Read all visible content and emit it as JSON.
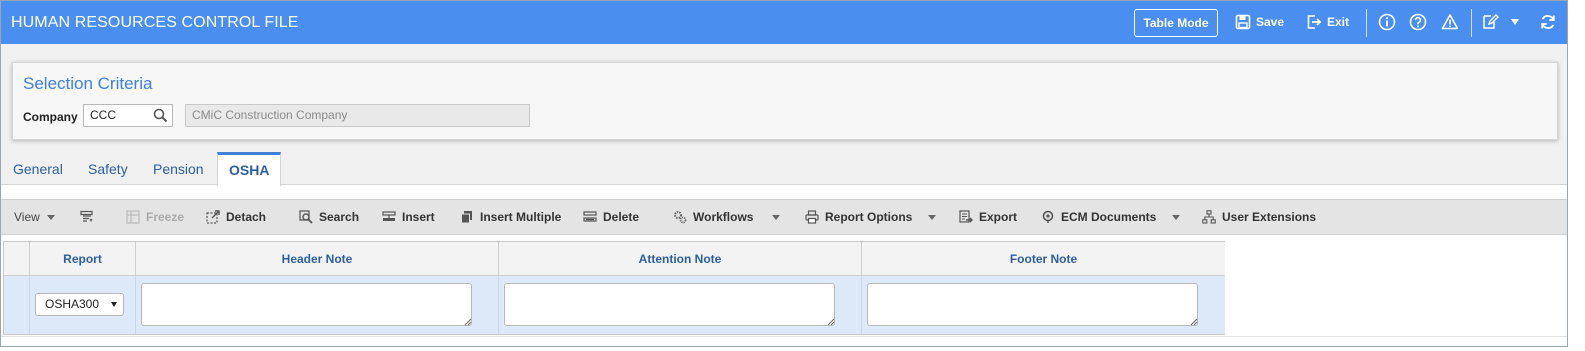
{
  "header": {
    "title": "HUMAN RESOURCES CONTROL FILE",
    "table_mode_label": "Table Mode",
    "save_label": "Save",
    "exit_label": "Exit",
    "bg_color": "#4a8ef0"
  },
  "criteria": {
    "title": "Selection Criteria",
    "company_label": "Company",
    "company_value": "CCC",
    "company_name": "CMiC Construction Company"
  },
  "tabs": [
    {
      "label": "General",
      "active": false
    },
    {
      "label": "Safety",
      "active": false
    },
    {
      "label": "Pension",
      "active": false
    },
    {
      "label": "OSHA",
      "active": true
    }
  ],
  "toolbar": {
    "view": "View",
    "freeze": "Freeze",
    "detach": "Detach",
    "search": "Search",
    "insert": "Insert",
    "insert_multiple": "Insert Multiple",
    "delete": "Delete",
    "workflows": "Workflows",
    "report_options": "Report Options",
    "export": "Export",
    "ecm_documents": "ECM Documents",
    "user_extensions": "User Extensions"
  },
  "grid": {
    "columns": [
      "Report",
      "Header Note",
      "Attention Note",
      "Footer Note"
    ],
    "rows": [
      {
        "report": "OSHA300",
        "header_note": "",
        "attention_note": "",
        "footer_note": ""
      }
    ]
  }
}
